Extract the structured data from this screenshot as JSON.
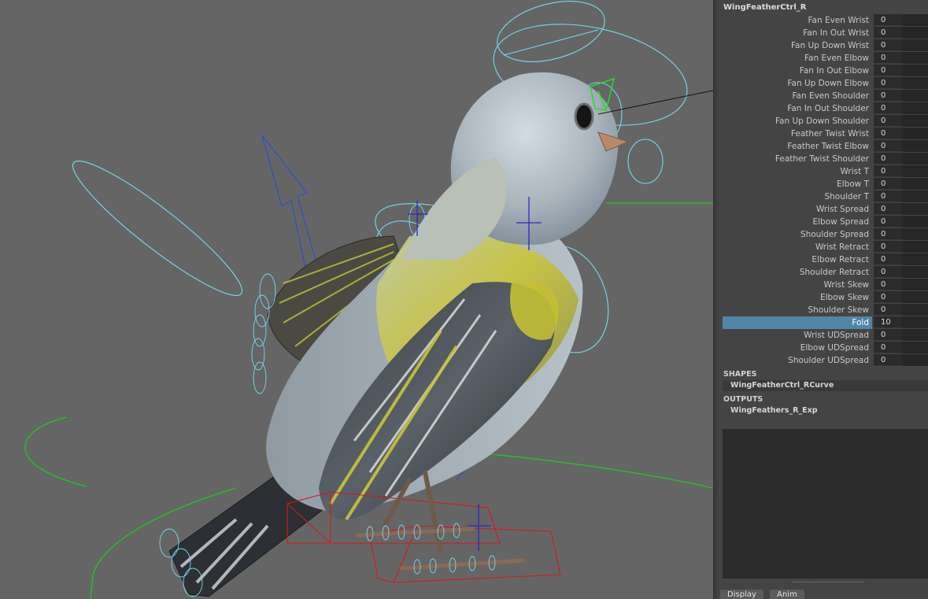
{
  "node_name": "WingFeatherCtrl_R",
  "attributes": [
    {
      "label": "Fan Even Wrist",
      "value": "0"
    },
    {
      "label": "Fan In Out Wrist",
      "value": "0"
    },
    {
      "label": "Fan Up Down Wrist",
      "value": "0"
    },
    {
      "label": "Fan Even Elbow",
      "value": "0"
    },
    {
      "label": "Fan In Out Elbow",
      "value": "0"
    },
    {
      "label": "Fan Up Down Elbow",
      "value": "0"
    },
    {
      "label": "Fan Even Shoulder",
      "value": "0"
    },
    {
      "label": "Fan In Out Shoulder",
      "value": "0"
    },
    {
      "label": "Fan Up Down Shoulder",
      "value": "0"
    },
    {
      "label": "Feather Twist Wrist",
      "value": "0"
    },
    {
      "label": "Feather Twist Elbow",
      "value": "0"
    },
    {
      "label": "Feather Twist Shoulder",
      "value": "0"
    },
    {
      "label": "Wrist T",
      "value": "0"
    },
    {
      "label": "Elbow T",
      "value": "0"
    },
    {
      "label": "Shoulder T",
      "value": "0"
    },
    {
      "label": "Wrist Spread",
      "value": "0"
    },
    {
      "label": "Elbow Spread",
      "value": "0"
    },
    {
      "label": "Shoulder Spread",
      "value": "0"
    },
    {
      "label": "Wrist Retract",
      "value": "0"
    },
    {
      "label": "Elbow Retract",
      "value": "0"
    },
    {
      "label": "Shoulder Retract",
      "value": "0"
    },
    {
      "label": "Wrist Skew",
      "value": "0"
    },
    {
      "label": "Elbow Skew",
      "value": "0"
    },
    {
      "label": "Shoulder Skew",
      "value": "0"
    },
    {
      "label": "Fold",
      "value": "10",
      "selected": true
    },
    {
      "label": "Wrist UDSpread",
      "value": "0"
    },
    {
      "label": "Elbow UDSpread",
      "value": "0"
    },
    {
      "label": "Shoulder UDSpread",
      "value": "0"
    }
  ],
  "shapes": {
    "header": "SHAPES",
    "items": [
      "WingFeatherCtrl_RCurve"
    ]
  },
  "outputs": {
    "header": "OUTPUTS",
    "items": [
      "WingFeathers_R_Exp"
    ]
  },
  "tabs": [
    "Display",
    "Anim"
  ],
  "colors": {
    "viewport_bg": "#656565",
    "selected_row": "#5285a6",
    "nurbs_curve": "#78d8f0",
    "joint": "#2a4fd0",
    "ground_curve": "#1ec81e",
    "foot_box": "#d81818"
  }
}
